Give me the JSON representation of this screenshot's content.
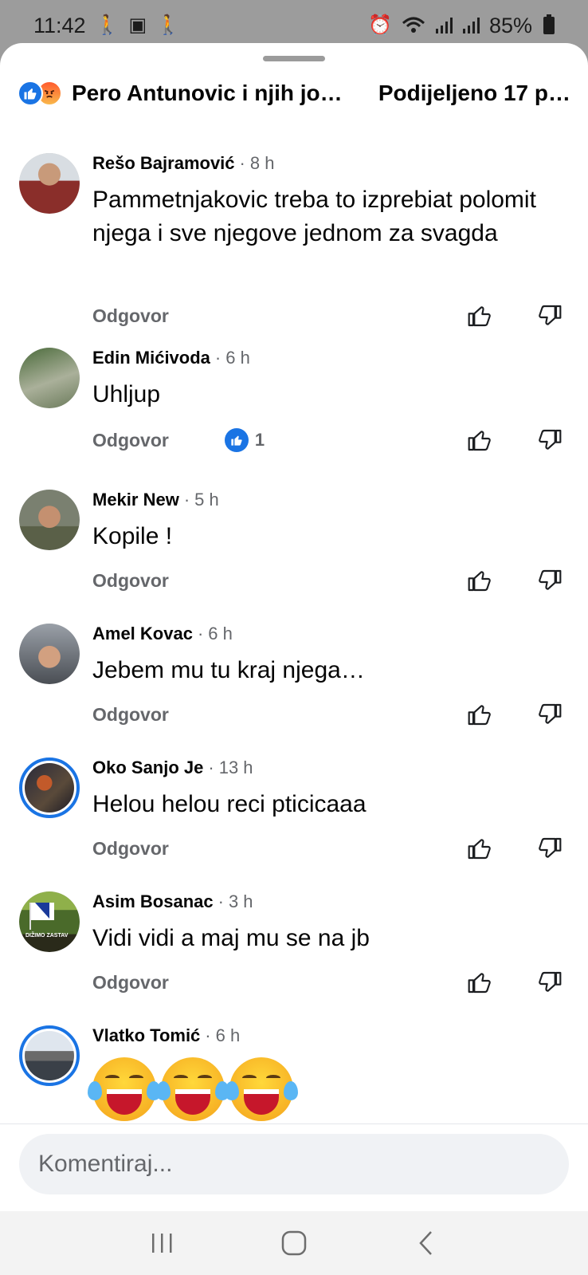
{
  "status_bar": {
    "time": "11:42",
    "battery": "85%",
    "icons": [
      "walk-icon",
      "image-icon",
      "walk-icon",
      "alarm-icon",
      "wifi-icon",
      "signal-icon",
      "signal-icon",
      "battery-icon"
    ]
  },
  "header": {
    "reaction_icons": [
      "like-icon",
      "angry-icon"
    ],
    "names": "Pero Antunovic i njih jo…",
    "shares": "Podijeljeno 17 p…"
  },
  "comments": [
    {
      "name": "Rešo Bajramović",
      "time": "8 h",
      "text": "Pammetnjakovic treba to izprebiat polomit njega i sve njegove jednom za svagda",
      "reply": "Odgovor",
      "avatar_color": "#8a5a3a"
    },
    {
      "name": "Edin Mićivoda",
      "time": "6 h",
      "text": "Uhljup",
      "reply": "Odgovor",
      "reactions": "1",
      "avatar_color": "#7a8a6a"
    },
    {
      "name": "Mekir New",
      "time": "5 h",
      "text": "Kopile !",
      "reply": "Odgovor",
      "avatar_color": "#5a5a4e"
    },
    {
      "name": "Amel Kovac",
      "time": "6 h",
      "text": "Jebem mu tu kraj njega…",
      "reply": "Odgovor",
      "avatar_color": "#6a6e74"
    },
    {
      "name": "Oko Sanjo Je",
      "time": "13 h",
      "text": "Helou helou reci pticicaaa",
      "reply": "Odgovor",
      "avatar_color": "#3a3a48"
    },
    {
      "name": "Asim Bosanac",
      "time": "3 h",
      "text": "Vidi vidi  a maj mu se na jb",
      "reply": "Odgovor",
      "avatar_color": "#6f8a3c",
      "avatar_text": "DIŽIMO ZASTAV"
    },
    {
      "name": "Vlatko Tomić",
      "time": "6 h",
      "emoji_count": 3,
      "avatar_color": "#4a5a6a"
    }
  ],
  "composer": {
    "placeholder": "Komentiraj..."
  },
  "nav": [
    "recent-apps-icon",
    "home-icon",
    "back-icon"
  ]
}
